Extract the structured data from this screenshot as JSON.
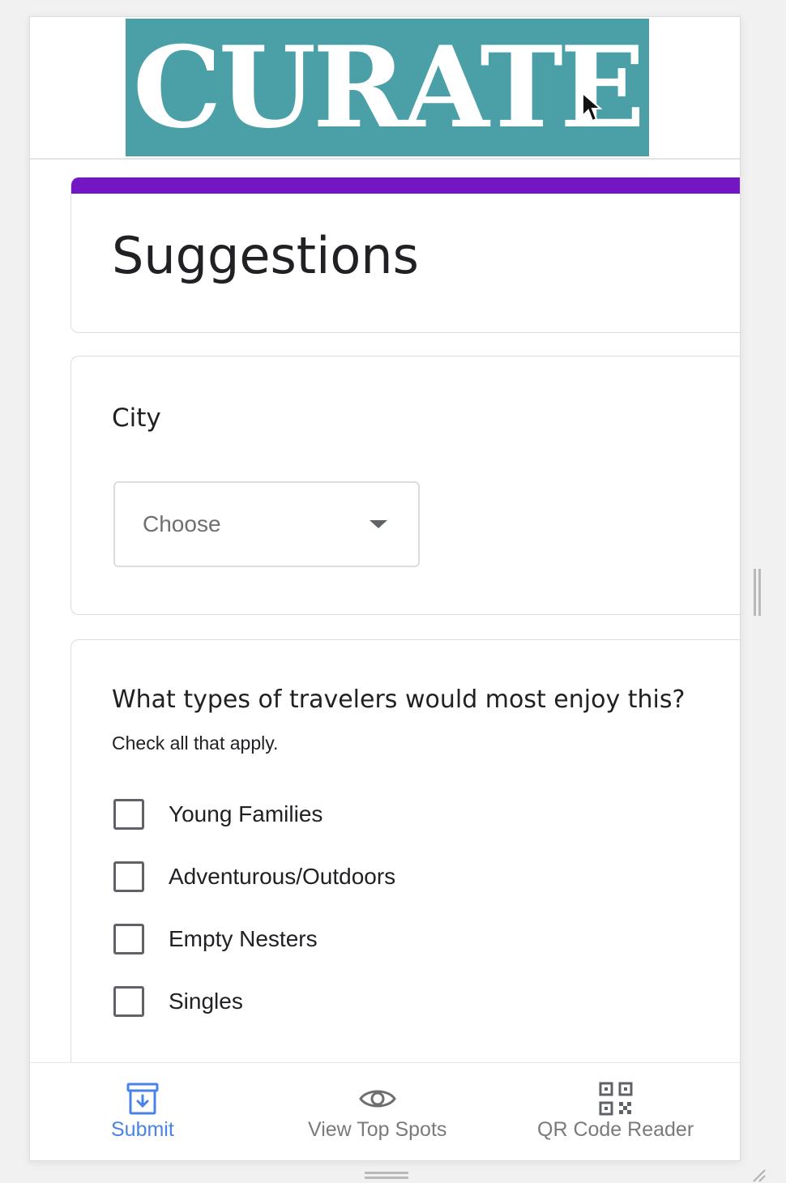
{
  "header": {
    "logo_text": "CURATE",
    "logo_bg": "#4aa0a6"
  },
  "form": {
    "accent_color": "#7316c4",
    "title": "Suggestions",
    "questions": [
      {
        "label": "City",
        "type": "dropdown",
        "value": "Choose"
      },
      {
        "label": "What types of travelers would most enjoy this?",
        "helper": "Check all that apply.",
        "type": "checkbox",
        "options": [
          {
            "label": "Young Families",
            "checked": false
          },
          {
            "label": "Adventurous/Outdoors",
            "checked": false
          },
          {
            "label": "Empty Nesters",
            "checked": false
          },
          {
            "label": "Singles",
            "checked": false
          }
        ]
      }
    ]
  },
  "bottom_nav": {
    "active_color": "#4a83e8",
    "items": [
      {
        "label": "Submit",
        "icon": "inbox-download-icon",
        "active": true
      },
      {
        "label": "View Top Spots",
        "icon": "eye-icon",
        "active": false
      },
      {
        "label": "QR Code Reader",
        "icon": "qr-code-icon",
        "active": false
      }
    ]
  }
}
